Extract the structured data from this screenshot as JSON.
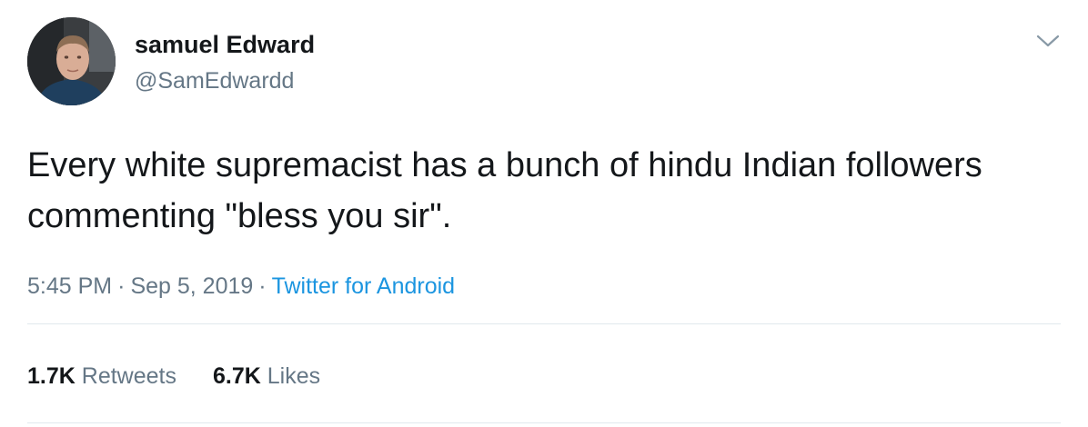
{
  "user": {
    "name": "samuel Edward",
    "handle": "@SamEdwardd"
  },
  "tweet": {
    "text": "Every white supremacist has a bunch of hindu Indian followers commenting \"bless you sir\"."
  },
  "meta": {
    "time": "5:45 PM",
    "separator": "·",
    "date": "Sep 5, 2019",
    "source": "Twitter for Android"
  },
  "stats": {
    "retweets_count": "1.7K",
    "retweets_label": "Retweets",
    "likes_count": "6.7K",
    "likes_label": "Likes"
  },
  "icons": {
    "menu": "chevron-down-icon"
  },
  "colors": {
    "text": "#14171a",
    "secondary": "#657786",
    "link": "#1b95e0",
    "divider": "#e1e8ed"
  }
}
